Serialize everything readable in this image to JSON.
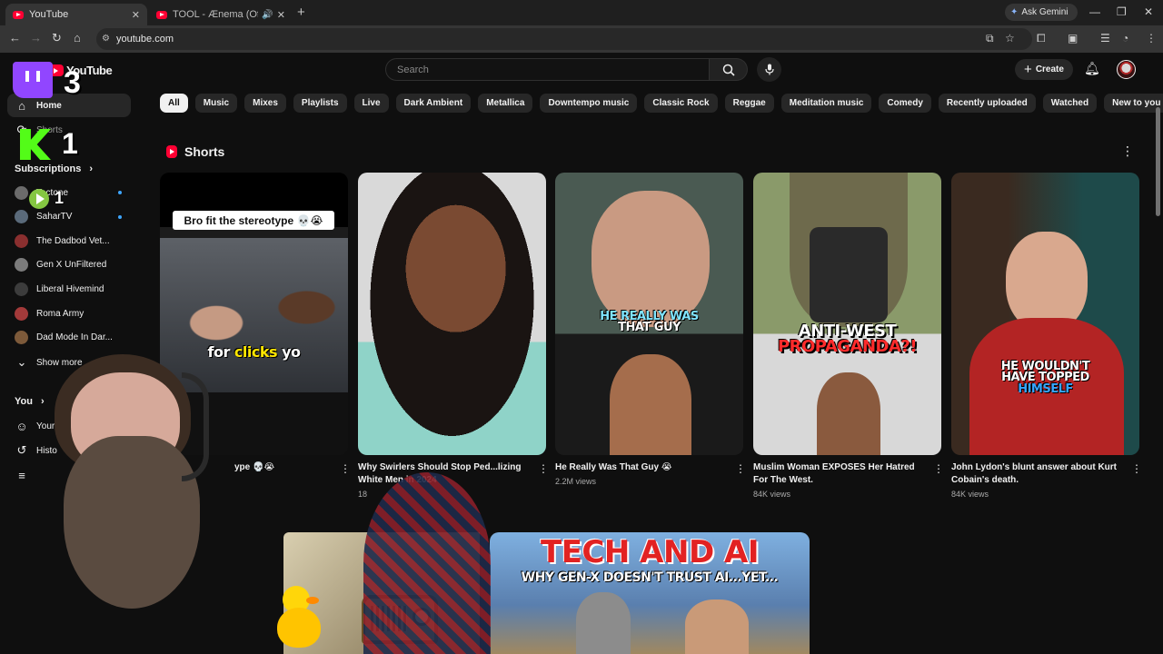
{
  "browser": {
    "tabs": [
      {
        "title": "YouTube",
        "active": true
      },
      {
        "title": "TOOL - Ænema (Official Vid",
        "active": false,
        "audio": true
      }
    ],
    "gemini_label": "Ask Gemini",
    "url": "youtube.com"
  },
  "masthead": {
    "logo_text": "YouTube",
    "search_placeholder": "Search",
    "create_label": "Create"
  },
  "chips": [
    "All",
    "Music",
    "Mixes",
    "Playlists",
    "Live",
    "Dark Ambient",
    "Metallica",
    "Downtempo music",
    "Classic Rock",
    "Reggae",
    "Meditation music",
    "Comedy",
    "Recently uploaded",
    "Watched",
    "New to you"
  ],
  "sidebar": {
    "main": [
      {
        "label": "Home",
        "icon": "home-icon"
      },
      {
        "label": "Shorts",
        "icon": "shorts-icon"
      }
    ],
    "subscriptions_heading": "Subscriptions",
    "subscriptions": [
      {
        "label": "Tectone",
        "color": "#6b6b6b"
      },
      {
        "label": "SaharTV",
        "color": "#5a6a7a"
      },
      {
        "label": "The Dadbod Vet...",
        "color": "#8a2f2f"
      },
      {
        "label": "Gen X UnFiltered",
        "color": "#7b7b7b"
      },
      {
        "label": "Liberal Hivemind",
        "color": "#3c3c3c"
      },
      {
        "label": "Roma Army",
        "color": "#a33a3a"
      },
      {
        "label": "Dad Mode In Dar...",
        "color": "#7d5a3a"
      }
    ],
    "show_more": "Show more",
    "you_heading": "You",
    "you_items": [
      {
        "label": "Your cha",
        "icon": "your-channel-icon"
      },
      {
        "label": "Histo",
        "icon": "history-icon"
      }
    ]
  },
  "shorts": {
    "heading": "Shorts",
    "items": [
      {
        "title": "ype 💀😭",
        "views": "",
        "caption_top": "Bro fit the stereotype 💀😭",
        "caption_bottom_a": "for ",
        "caption_bottom_b": "clicks",
        "caption_bottom_c": " yo"
      },
      {
        "title": "Why Swirlers Should Stop Ped...lizing White Men in 2024",
        "views": "18",
        "caption": ""
      },
      {
        "title": "He Really Was That Guy 😭",
        "views": "2.2M views",
        "caption_a": "HE REALLY WAS",
        "caption_b": "THAT GUY"
      },
      {
        "title": "Muslim Woman EXPOSES Her Hatred For The West.",
        "views": "84K views",
        "caption_a": "ANTI-WEST",
        "caption_b": "PROPAGANDA?!"
      },
      {
        "title": "John Lydon's blunt answer about Kurt Cobain's death.",
        "views": "84K views",
        "caption_a": "HE WOULDN'T",
        "caption_b": "HAVE TOPPED",
        "caption_c": "HIMSELF"
      }
    ]
  },
  "videos": [
    {
      "thumb_line1": "TECH AND AI",
      "thumb_line2": "WHY GEN-X DOESN'T TRUST AI...YET..."
    }
  ],
  "overlay": {
    "twitch_count": "3",
    "kick_count": "1",
    "rumble_count": "1"
  },
  "colors": {
    "background": "#0f0f0f",
    "chip": "#272727",
    "accent_red": "#ff0033",
    "new_dot": "#3ea6ff",
    "twitch": "#9146ff",
    "kick": "#53fc18"
  }
}
